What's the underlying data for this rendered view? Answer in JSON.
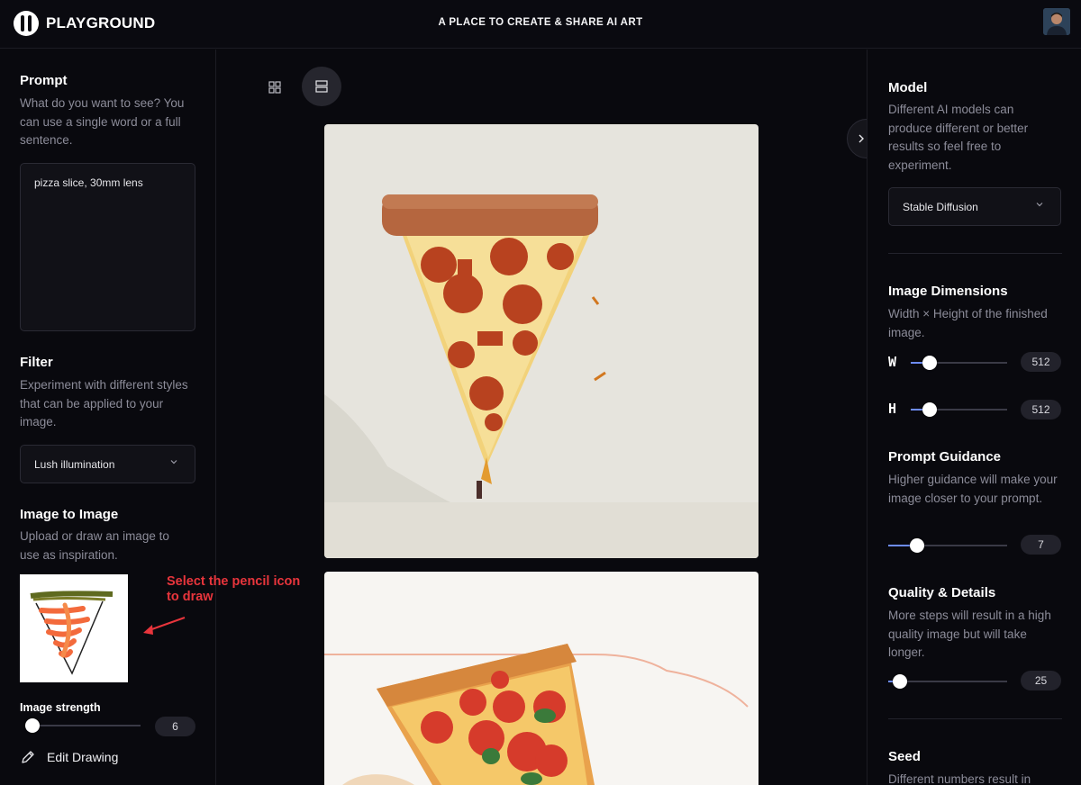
{
  "header": {
    "brand": "PLAYGROUND",
    "tagline": "A PLACE TO CREATE & SHARE AI ART"
  },
  "left_panel": {
    "prompt": {
      "title": "Prompt",
      "description": "What do you want to see? You can use a single word or a full sentence.",
      "value": "pizza slice, 30mm lens"
    },
    "filter": {
      "title": "Filter",
      "description": "Experiment with different styles that can be applied to your image.",
      "selected": "Lush illumination"
    },
    "image_to_image": {
      "title": "Image to Image",
      "description": "Upload or draw an image to use as inspiration.",
      "annotation": "Select the pencil icon to draw",
      "strength_label": "Image strength",
      "strength_value": "6",
      "strength_fraction": 0.05,
      "edit_label": "Edit Drawing"
    }
  },
  "right_panel": {
    "model": {
      "title": "Model",
      "description": "Different AI models can produce different or better results so feel free to experiment.",
      "selected": "Stable Diffusion"
    },
    "dimensions": {
      "title": "Image Dimensions",
      "description": "Width × Height of the finished image.",
      "width_label": "W",
      "width_value": "512",
      "width_fraction": 0.2,
      "height_label": "H",
      "height_value": "512",
      "height_fraction": 0.2
    },
    "guidance": {
      "title": "Prompt Guidance",
      "description": "Higher guidance will make your image closer to your prompt.",
      "value": "7",
      "fraction": 0.24
    },
    "quality": {
      "title": "Quality & Details",
      "description": "More steps will result in a high quality image but will take longer.",
      "value": "25",
      "fraction": 0.1
    },
    "seed": {
      "title": "Seed",
      "description": "Different numbers result in"
    }
  },
  "colors": {
    "accent": "#6d8cf7",
    "annotation": "#e8353c",
    "background": "#09090e"
  }
}
